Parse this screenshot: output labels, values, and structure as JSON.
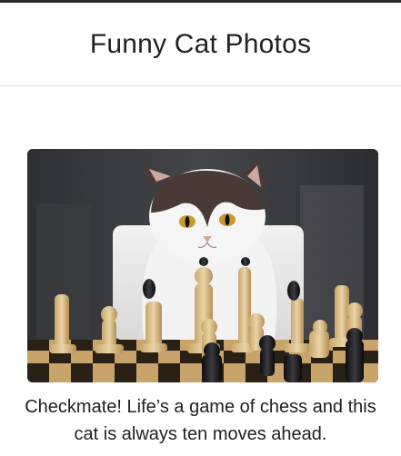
{
  "header": {
    "title": "Funny Cat Photos"
  },
  "post": {
    "image_icon": "cat-chess-photo",
    "caption": "Checkmate! Life’s a game of chess and this cat is always ten moves ahead."
  },
  "colors": {
    "top_bar": "#2b2b2b",
    "divider": "#dedede",
    "text": "#222222"
  }
}
